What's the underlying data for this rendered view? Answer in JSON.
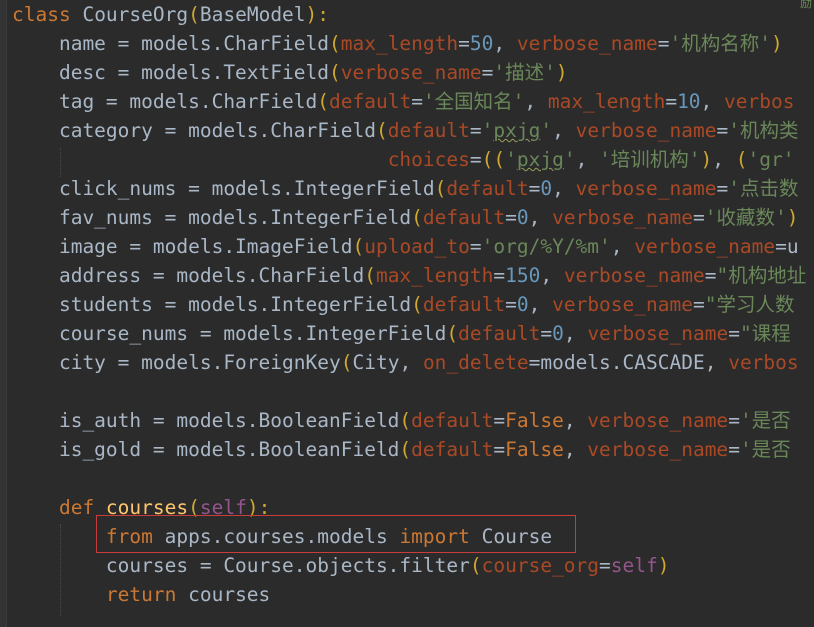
{
  "editor": {
    "language": "python",
    "corner_mark": "励",
    "lines": {
      "l1": [
        [
          "kw",
          "class "
        ],
        [
          "t",
          "CourseOrg"
        ],
        [
          "paren",
          "("
        ],
        [
          "t",
          "BaseModel"
        ],
        [
          "paren",
          "):"
        ]
      ],
      "l2": [
        [
          "t",
          "    name = models.CharField"
        ],
        [
          "paren",
          "("
        ],
        [
          "p",
          "max_length"
        ],
        [
          "t",
          "="
        ],
        [
          "num",
          "50"
        ],
        [
          "t",
          ", "
        ],
        [
          "p",
          "verbose_name"
        ],
        [
          "t",
          "="
        ],
        [
          "str",
          "'机构名称'"
        ],
        [
          "paren",
          ")"
        ]
      ],
      "l3": [
        [
          "t",
          "    desc = models.TextField"
        ],
        [
          "paren",
          "("
        ],
        [
          "p",
          "verbose_name"
        ],
        [
          "t",
          "="
        ],
        [
          "str",
          "'描述'"
        ],
        [
          "paren",
          ")"
        ]
      ],
      "l4": [
        [
          "t",
          "    tag = models.CharField"
        ],
        [
          "paren",
          "("
        ],
        [
          "p",
          "default"
        ],
        [
          "t",
          "="
        ],
        [
          "str",
          "'全国知名'"
        ],
        [
          "t",
          ", "
        ],
        [
          "p",
          "max_length"
        ],
        [
          "t",
          "="
        ],
        [
          "num",
          "10"
        ],
        [
          "t",
          ", "
        ],
        [
          "p",
          "verbos"
        ]
      ],
      "l5": [
        [
          "t",
          "    category = models.CharField"
        ],
        [
          "paren",
          "("
        ],
        [
          "p",
          "default"
        ],
        [
          "t",
          "="
        ],
        [
          "str",
          "'"
        ],
        [
          "sq",
          "pxjg"
        ],
        [
          "str",
          "'"
        ],
        [
          "t",
          ", "
        ],
        [
          "p",
          "verbose_name"
        ],
        [
          "t",
          "="
        ],
        [
          "str",
          "'机构类"
        ]
      ],
      "l6": [
        [
          "t",
          "                                "
        ],
        [
          "p",
          "choices"
        ],
        [
          "t",
          "="
        ],
        [
          "paren",
          "(("
        ],
        [
          "str",
          "'"
        ],
        [
          "sq",
          "pxjg"
        ],
        [
          "str",
          "'"
        ],
        [
          "t",
          ", "
        ],
        [
          "str",
          "'培训机构'"
        ],
        [
          "paren",
          ")"
        ],
        [
          "t",
          ", "
        ],
        [
          "paren",
          "("
        ],
        [
          "str",
          "'gr'"
        ]
      ],
      "l7": [
        [
          "t",
          "    click_nums = models.IntegerField"
        ],
        [
          "paren",
          "("
        ],
        [
          "p",
          "default"
        ],
        [
          "t",
          "="
        ],
        [
          "num",
          "0"
        ],
        [
          "t",
          ", "
        ],
        [
          "p",
          "verbose_name"
        ],
        [
          "t",
          "="
        ],
        [
          "str",
          "'点击数"
        ]
      ],
      "l8": [
        [
          "t",
          "    fav_nums = models.IntegerField"
        ],
        [
          "paren",
          "("
        ],
        [
          "p",
          "default"
        ],
        [
          "t",
          "="
        ],
        [
          "num",
          "0"
        ],
        [
          "t",
          ", "
        ],
        [
          "p",
          "verbose_name"
        ],
        [
          "t",
          "="
        ],
        [
          "str",
          "'收藏数'"
        ],
        [
          "paren",
          ")"
        ]
      ],
      "l9": [
        [
          "t",
          "    image = models.ImageField"
        ],
        [
          "paren",
          "("
        ],
        [
          "p",
          "upload_to"
        ],
        [
          "t",
          "="
        ],
        [
          "str",
          "'org/%Y/%m'"
        ],
        [
          "t",
          ", "
        ],
        [
          "p",
          "verbose_name"
        ],
        [
          "t",
          "=u"
        ]
      ],
      "l10": [
        [
          "t",
          "    address = models.CharField"
        ],
        [
          "paren",
          "("
        ],
        [
          "p",
          "max_length"
        ],
        [
          "t",
          "="
        ],
        [
          "num",
          "150"
        ],
        [
          "t",
          ", "
        ],
        [
          "p",
          "verbose_name"
        ],
        [
          "t",
          "="
        ],
        [
          "str",
          "\"机构地址"
        ]
      ],
      "l11": [
        [
          "t",
          "    students = models.IntegerField"
        ],
        [
          "paren",
          "("
        ],
        [
          "p",
          "default"
        ],
        [
          "t",
          "="
        ],
        [
          "num",
          "0"
        ],
        [
          "t",
          ", "
        ],
        [
          "p",
          "verbose_name"
        ],
        [
          "t",
          "="
        ],
        [
          "str",
          "\"学习人数"
        ]
      ],
      "l12": [
        [
          "t",
          "    course_nums = models.IntegerField"
        ],
        [
          "paren",
          "("
        ],
        [
          "p",
          "default"
        ],
        [
          "t",
          "="
        ],
        [
          "num",
          "0"
        ],
        [
          "t",
          ", "
        ],
        [
          "p",
          "verbose_name"
        ],
        [
          "t",
          "="
        ],
        [
          "str",
          "\"课程"
        ]
      ],
      "l13": [
        [
          "t",
          "    city = models.ForeignKey"
        ],
        [
          "paren",
          "("
        ],
        [
          "t",
          "City, "
        ],
        [
          "p",
          "on_delete"
        ],
        [
          "t",
          "=models.CASCADE, "
        ],
        [
          "p",
          "verbos"
        ]
      ],
      "l14": [],
      "l15": [
        [
          "t",
          "    is_auth = models.BooleanField"
        ],
        [
          "paren",
          "("
        ],
        [
          "p",
          "default"
        ],
        [
          "t",
          "="
        ],
        [
          "kw",
          "False"
        ],
        [
          "t",
          ", "
        ],
        [
          "p",
          "verbose_name"
        ],
        [
          "t",
          "="
        ],
        [
          "str",
          "'是否"
        ]
      ],
      "l16": [
        [
          "t",
          "    is_gold = models.BooleanField"
        ],
        [
          "paren",
          "("
        ],
        [
          "p",
          "default"
        ],
        [
          "t",
          "="
        ],
        [
          "kw",
          "False"
        ],
        [
          "t",
          ", "
        ],
        [
          "p",
          "verbose_name"
        ],
        [
          "t",
          "="
        ],
        [
          "str",
          "'是否"
        ]
      ],
      "l17": [],
      "l18": [
        [
          "kw",
          "    def "
        ],
        [
          "fn",
          "courses"
        ],
        [
          "paren",
          "("
        ],
        [
          "self",
          "self"
        ],
        [
          "paren",
          "):"
        ]
      ],
      "l19": [
        [
          "kw",
          "        from "
        ],
        [
          "t",
          "apps.courses.models "
        ],
        [
          "kw",
          "import "
        ],
        [
          "t",
          "Course"
        ]
      ],
      "l20": [
        [
          "t",
          "        courses = Course.objects.filter"
        ],
        [
          "paren",
          "("
        ],
        [
          "p",
          "course_org"
        ],
        [
          "t",
          "="
        ],
        [
          "self",
          "self"
        ],
        [
          "paren",
          ")"
        ]
      ],
      "l21": [
        [
          "kw",
          "        return "
        ],
        [
          "t",
          "courses"
        ]
      ]
    }
  }
}
